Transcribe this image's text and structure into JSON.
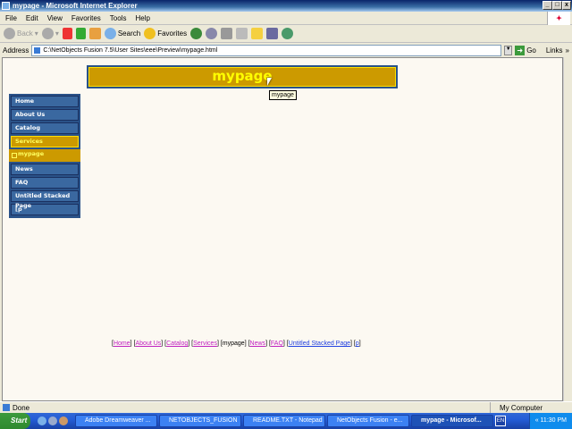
{
  "window": {
    "title": "mypage - Microsoft Internet Explorer"
  },
  "menu": [
    "File",
    "Edit",
    "View",
    "Favorites",
    "Tools",
    "Help"
  ],
  "toolbar": {
    "back": "Back",
    "search": "Search",
    "favorites": "Favorites"
  },
  "address": {
    "label": "Address",
    "value": "C:\\NetObjects Fusion 7.5\\User Sites\\eee\\Preview\\mypage.html",
    "go": "Go",
    "links": "Links"
  },
  "page": {
    "banner": "mypage",
    "tooltip": "mypage",
    "nav": [
      {
        "label": "Home",
        "state": "normal"
      },
      {
        "label": "About Us",
        "state": "normal"
      },
      {
        "label": "Catalog",
        "state": "normal"
      },
      {
        "label": "Services",
        "state": "active"
      },
      {
        "label": "mypage",
        "state": "current-sub"
      },
      {
        "label": "News",
        "state": "normal"
      },
      {
        "label": "FAQ",
        "state": "normal"
      },
      {
        "label": "Untitled Stacked Page",
        "state": "normal"
      },
      {
        "label": "[p",
        "state": "normal"
      }
    ],
    "footer": [
      "Home",
      "About Us",
      "Catalog",
      "Services",
      "mypage",
      "News",
      "FAQ",
      "Untitled Stacked Page",
      "p"
    ]
  },
  "status": {
    "text": "Done",
    "zone": "My Computer"
  },
  "taskbar": {
    "start": "Start",
    "tasks": [
      "Adobe Dreamweaver ...",
      "NETOBJECTS_FUSION",
      "README.TXT - Notepad",
      "NetObjects Fusion - e...",
      "mypage - Microsof..."
    ],
    "lang": "EN",
    "clock": "11:30 PM"
  }
}
